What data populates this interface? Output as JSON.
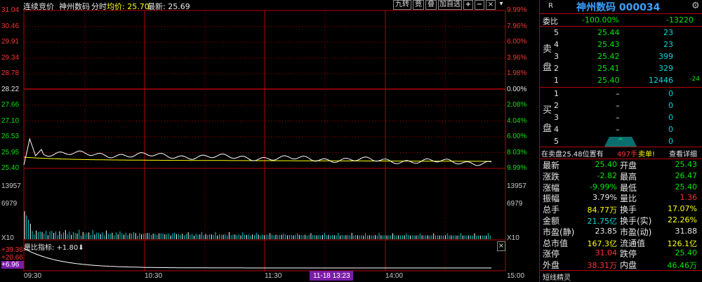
{
  "topbar": {
    "mode": "连续竞价",
    "name": "神州数码",
    "view": "分时",
    "avg_label": "均价: 25.70",
    "last_label": "最新: 25.69",
    "buttons": [
      "九转",
      "竟",
      "叠",
      "加自选"
    ],
    "plus": "+",
    "minus": "−",
    "close": "×"
  },
  "price_axis_left": [
    "31.04",
    "30.46",
    "29.91",
    "29.34",
    "28.78",
    "28.22",
    "27.66",
    "27.10",
    "26.53",
    "25.95",
    "25.40"
  ],
  "price_axis_right": [
    "9.99%",
    "7.96%",
    "6.00%",
    "3.96%",
    "1.98%",
    "0.00%",
    "2.08%",
    "4.04%",
    "6.00%",
    "8.03%",
    "9.99%"
  ],
  "volume_axis": {
    "left": [
      "13957",
      "6979",
      "X10"
    ],
    "right": [
      "13957",
      "6979",
      "X10"
    ]
  },
  "indicator": {
    "label": "量比指标: +1.80⬇",
    "axis": [
      "+39.36",
      "+20.66",
      "+6.96"
    ],
    "close": "×"
  },
  "time_axis": [
    "09:30",
    "10:30",
    "11:30",
    "14:00",
    "15:00"
  ],
  "cursor_time": "11-18 13:23",
  "colors": {
    "up": "#ff3232",
    "down": "#00e600",
    "grid": "#b40000",
    "price_line": "#ffffff",
    "avg_line": "#ffff00"
  },
  "panel": {
    "r": "R",
    "title": "神州数码 000034",
    "gear": "⚙",
    "weibi_label": "委比",
    "weibi_pct": "-100.00%",
    "weibi_val": "-13220",
    "sell_label": [
      "卖",
      "盘"
    ],
    "buy_label": [
      "买",
      "盘"
    ],
    "sells": [
      {
        "level": "5",
        "price": "25.44",
        "vol": "23",
        "chg": ""
      },
      {
        "level": "4",
        "price": "25.43",
        "vol": "23",
        "chg": ""
      },
      {
        "level": "3",
        "price": "25.42",
        "vol": "399",
        "chg": ""
      },
      {
        "level": "2",
        "price": "25.41",
        "vol": "329",
        "chg": ""
      },
      {
        "level": "1",
        "price": "25.40",
        "vol": "12446",
        "chg": "-24"
      }
    ],
    "buys": [
      {
        "level": "1",
        "price": "–",
        "vol": "0"
      },
      {
        "level": "2",
        "price": "–",
        "vol": "0"
      },
      {
        "level": "3",
        "price": "–",
        "vol": "0"
      },
      {
        "level": "4",
        "price": "–",
        "vol": "0"
      },
      {
        "level": "5",
        "price": "–",
        "vol": "0"
      }
    ],
    "scroll_up": "^",
    "position_text": "在卖盘25.48位置有",
    "position_count": "497手",
    "position_side": "卖单!",
    "detail_link": "查看详细",
    "stats": [
      {
        "l1": "最新",
        "v1": "25.40",
        "c1": "green",
        "l2": "开盘",
        "v2": "25.43",
        "c2": "green",
        "x": ""
      },
      {
        "l1": "涨跌",
        "v1": "-2.82",
        "c1": "green",
        "l2": "最高",
        "v2": "26.47",
        "c2": "green",
        "x": ""
      },
      {
        "l1": "涨幅",
        "v1": "-9.99%",
        "c1": "green",
        "l2": "最低",
        "v2": "25.40",
        "c2": "green",
        "x": ""
      },
      {
        "l1": "振幅",
        "v1": "3.79%",
        "c1": "white",
        "l2": "量比",
        "v2": "1.36",
        "c2": "red",
        "x": ""
      },
      {
        "l1": "总手",
        "v1": "84.77万",
        "c1": "yellow",
        "l2": "换手",
        "v2": "17.07%",
        "c2": "yellow",
        "x": ""
      },
      {
        "l1": "金额",
        "v1": "21.75亿",
        "c1": "cyan",
        "l2": "换手(实)",
        "v2": "22.26%",
        "c2": "yellow",
        "x": ""
      },
      {
        "l1": "市盈(静)",
        "v1": "23.85",
        "c1": "white",
        "l2": "市盈(动)",
        "v2": "31.88",
        "c2": "white",
        "x": ""
      },
      {
        "l1": "总市值",
        "v1": "167.3亿",
        "c1": "yellow",
        "l2": "流通值",
        "v2": "126.1亿",
        "c2": "yellow",
        "x": ""
      },
      {
        "l1": "涨停",
        "v1": "31.04",
        "c1": "red",
        "l2": "跌停",
        "v2": "25.40",
        "c2": "green",
        "x": ""
      },
      {
        "l1": "外盘",
        "v1": "38.31万",
        "c1": "red",
        "l2": "内盘",
        "v2": "46.46万",
        "c2": "green",
        "x": ""
      }
    ],
    "footer": "短线精灵"
  }
}
